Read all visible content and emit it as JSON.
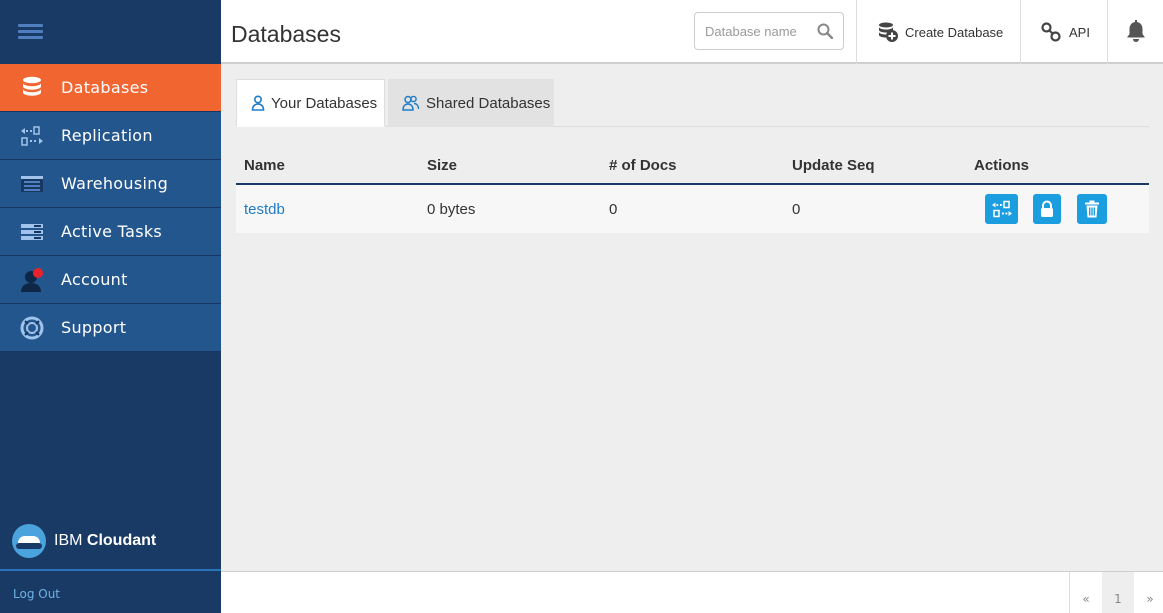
{
  "sidebar": {
    "items": [
      {
        "label": "Databases",
        "icon": "database-icon",
        "active": true
      },
      {
        "label": "Replication",
        "icon": "replication-icon"
      },
      {
        "label": "Warehousing",
        "icon": "warehouse-icon"
      },
      {
        "label": "Active Tasks",
        "icon": "tasks-icon"
      },
      {
        "label": "Account",
        "icon": "account-icon"
      },
      {
        "label": "Support",
        "icon": "lifebuoy-icon"
      }
    ],
    "brand": {
      "prefix": "IBM",
      "name": "Cloudant"
    },
    "logout_label": "Log Out"
  },
  "header": {
    "title": "Databases",
    "search_placeholder": "Database name",
    "create_label": "Create Database",
    "api_label": "API"
  },
  "tabs": [
    {
      "label": "Your Databases",
      "active": true
    },
    {
      "label": "Shared Databases",
      "active": false
    }
  ],
  "table": {
    "columns": [
      "Name",
      "Size",
      "# of Docs",
      "Update Seq",
      "Actions"
    ],
    "rows": [
      {
        "name": "testdb",
        "size": "0 bytes",
        "docs": "0",
        "update_seq": "0"
      }
    ]
  },
  "pagination": {
    "prev": "«",
    "current": "1",
    "next": "»"
  },
  "colors": {
    "active_nav": "#f16531",
    "sidebar_bg": "#1a3a66",
    "nav_bg": "#24568e",
    "action_blue": "#1a9ee0",
    "link": "#1e7cc8"
  }
}
